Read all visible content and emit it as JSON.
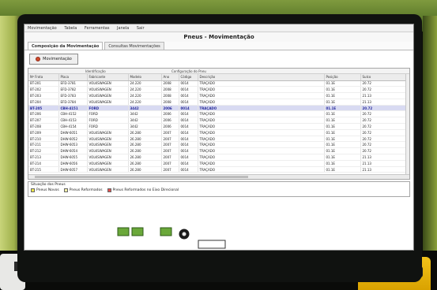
{
  "window": {
    "menu": [
      "Movimentação",
      "Tabela",
      "Ferramentas",
      "Janela",
      "Sair"
    ],
    "title": "Pneus - Movimentação"
  },
  "tabs": [
    {
      "label": "Composição da Movimentação",
      "active": true
    },
    {
      "label": "Consultas Movimentações",
      "active": false
    }
  ],
  "toolbar": {
    "move_label": "Movimentação"
  },
  "table": {
    "group_left": "Identificação",
    "group_right": "Configuração do Pneu",
    "columns": [
      "Nº Frota",
      "Placa",
      "Fabricante",
      "Modelo",
      "Ano",
      "Código",
      "Descrição",
      "Posição",
      "Sulco"
    ],
    "rows": [
      [
        "BT-201",
        "EFD-3781",
        "VOLKSWAGEN",
        "24.220",
        "2008",
        "0014",
        "TRAÇADO",
        "01.1E",
        "20.72"
      ],
      [
        "BT-202",
        "EFD-3782",
        "VOLKSWAGEN",
        "24.220",
        "2008",
        "0014",
        "TRAÇADO",
        "01.1E",
        "20.72"
      ],
      [
        "BT-203",
        "EFD-3783",
        "VOLKSWAGEN",
        "24.220",
        "2008",
        "0014",
        "TRAÇADO",
        "01.1E",
        "21.13"
      ],
      [
        "BT-204",
        "EFD-3784",
        "VOLKSWAGEN",
        "24.220",
        "2008",
        "0014",
        "TRAÇADO",
        "01.1E",
        "21.13"
      ],
      [
        "BT-205",
        "CBH-4151",
        "FORD",
        "3442",
        "2006",
        "0014",
        "TRAÇADO",
        "01.1E",
        "20.72"
      ],
      [
        "BT-206",
        "CBH-4152",
        "FORD",
        "3442",
        "2006",
        "0014",
        "TRAÇADO",
        "01.1E",
        "20.72"
      ],
      [
        "BT-207",
        "CBH-4153",
        "FORD",
        "3442",
        "2006",
        "0014",
        "TRAÇADO",
        "01.1E",
        "20.72"
      ],
      [
        "BT-208",
        "CBH-4154",
        "FORD",
        "3442",
        "2006",
        "0014",
        "TRAÇADO",
        "01.1E",
        "20.72"
      ],
      [
        "BT-209",
        "DHW-6051",
        "VOLKSWAGEN",
        "26.280",
        "2007",
        "0014",
        "TRAÇADO",
        "01.1E",
        "20.72"
      ],
      [
        "BT-210",
        "DHW-6052",
        "VOLKSWAGEN",
        "26.280",
        "2007",
        "0014",
        "TRAÇADO",
        "01.1E",
        "20.72"
      ],
      [
        "BT-211",
        "DHW-6053",
        "VOLKSWAGEN",
        "26.280",
        "2007",
        "0014",
        "TRAÇADO",
        "01.1E",
        "20.72"
      ],
      [
        "BT-212",
        "DHW-6054",
        "VOLKSWAGEN",
        "26.280",
        "2007",
        "0014",
        "TRAÇADO",
        "01.1E",
        "20.72"
      ],
      [
        "BT-213",
        "DHW-6055",
        "VOLKSWAGEN",
        "26.280",
        "2007",
        "0014",
        "TRAÇADO",
        "01.1E",
        "21.13"
      ],
      [
        "BT-214",
        "DHW-6056",
        "VOLKSWAGEN",
        "26.280",
        "2007",
        "0014",
        "TRAÇADO",
        "01.1E",
        "21.13"
      ],
      [
        "BT-215",
        "DHW-6057",
        "VOLKSWAGEN",
        "26.280",
        "2007",
        "0014",
        "TRAÇADO",
        "01.1E",
        "21.13"
      ]
    ],
    "selected_row": 4
  },
  "legend": {
    "title": "Situação dos Pneus",
    "items": [
      {
        "label": "Pneus Novos",
        "color": "#f2e84a"
      },
      {
        "label": "Pneus Reformados",
        "color": "#f5f0a8"
      },
      {
        "label": "Pneus Reformados no Eixo Direcional",
        "color": "#e35050"
      }
    ]
  },
  "colors": {
    "selected_row": "#d8daf2",
    "diagram_green": "#6aa83a"
  }
}
